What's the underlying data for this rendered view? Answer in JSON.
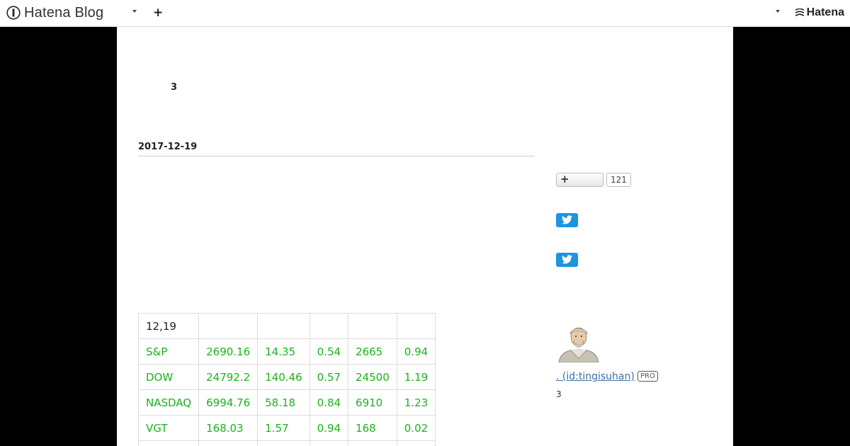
{
  "header": {
    "brand": "Hatena Blog",
    "plus_label": "+",
    "hatena_label": "Hatena"
  },
  "blog": {
    "title": "3",
    "entry_date": "2017-12-19"
  },
  "stock_table": {
    "rows": [
      [
        "12,19",
        "",
        "",
        "",
        "",
        ""
      ],
      [
        "S&P",
        "2690.16",
        "14.35",
        "0.54",
        "2665",
        "0.94"
      ],
      [
        "DOW",
        "24792.2",
        "140.46",
        "0.57",
        "24500",
        "1.19"
      ],
      [
        "NASDAQ",
        "6994.76",
        "58.18",
        "0.84",
        "6910",
        "1.23"
      ],
      [
        "VGT",
        "168.03",
        "1.57",
        "0.94",
        "168",
        "0.02"
      ],
      [
        "",
        "",
        "",
        "",
        "",
        ""
      ]
    ]
  },
  "sidebar": {
    "bookmark_plus": "+",
    "bookmark_count": "121",
    "profile_link": ". (id:tingisuhan)",
    "pro_badge": "PRO",
    "profile_count": "3"
  },
  "colors": {
    "positive_text": "#1bb31b",
    "twitter_blue": "#1b95e0",
    "link": "#3d6ea1"
  },
  "icons": {
    "brand": "hatena-blog-logo-icon",
    "twitter": "twitter-bird-icon",
    "dropdown": "caret-down-icon"
  }
}
